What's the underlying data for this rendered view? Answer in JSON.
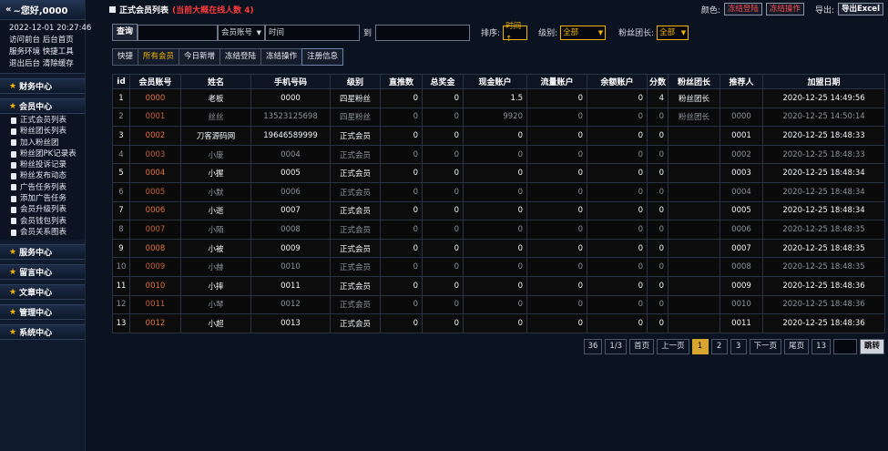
{
  "sidebar": {
    "greeting": "~您好,0000",
    "datetime": "2022-12-01 20:27:46",
    "links_row1": "访问前台 后台首页",
    "links_row2": "服务环境 快捷工具",
    "links_row3": "退出后台 清除缓存",
    "sections": {
      "finance": "财务中心",
      "member": "会员中心",
      "service": "服务中心",
      "message": "留言中心",
      "article": "文章中心",
      "manage": "管理中心",
      "system": "系统中心"
    },
    "member_items": [
      "正式会员列表",
      "粉丝团长列表",
      "加入粉丝团",
      "粉丝团PK记录表",
      "粉丝投诉记录",
      "粉丝发布动态",
      "广告任务列表",
      "添加广告任务",
      "会员升级列表",
      "会员钱包列表",
      "会员关系图表"
    ]
  },
  "header": {
    "title": "正式会员列表",
    "online_note": "(当前大概在线人数 4)",
    "color_label": "颜色:",
    "freeze_login": "冻结登陆",
    "freeze_op": "冻结操作",
    "export_label": "导出:",
    "export_excel": "导出Excel"
  },
  "search": {
    "query_btn": "查询",
    "field_select": "会员账号",
    "time_label": "时间",
    "to_label": "到",
    "sort_label": "排序:",
    "sort_value": "时间↑",
    "level_label": "级别:",
    "level_value": "全部",
    "fan_leader_label": "粉丝团长:",
    "fan_leader_value": "全部"
  },
  "tabs": [
    "快捷",
    "所有会员",
    "今日新增",
    "冻结登陆",
    "冻结操作",
    "注册信息"
  ],
  "table": {
    "headers": [
      "id",
      "会员账号",
      "姓名",
      "手机号码",
      "级别",
      "直推数",
      "总奖金",
      "现金账户",
      "流量账户",
      "余额账户",
      "分数",
      "粉丝团长",
      "推荐人",
      "加盟日期"
    ],
    "rows": [
      [
        "1",
        "0000",
        "老板",
        "0000",
        "四星粉丝",
        "0",
        "0",
        "1.5",
        "0",
        "0",
        "4",
        "粉丝团长",
        "",
        "2020-12-25 14:49:56"
      ],
      [
        "2",
        "0001",
        "丝丝",
        "13523125698",
        "四星粉丝",
        "0",
        "0",
        "9920",
        "0",
        "0",
        "0",
        "粉丝团长",
        "0000",
        "2020-12-25 14:50:14"
      ],
      [
        "3",
        "0002",
        "刀客源码网",
        "19646589999",
        "正式会员",
        "0",
        "0",
        "0",
        "0",
        "0",
        "0",
        "",
        "0001",
        "2020-12-25 18:48:33"
      ],
      [
        "4",
        "0003",
        "小废",
        "0004",
        "正式会员",
        "0",
        "0",
        "0",
        "0",
        "0",
        "0",
        "",
        "0002",
        "2020-12-25 18:48:33"
      ],
      [
        "5",
        "0004",
        "小握",
        "0005",
        "正式会员",
        "0",
        "0",
        "0",
        "0",
        "0",
        "0",
        "",
        "0003",
        "2020-12-25 18:48:34"
      ],
      [
        "6",
        "0005",
        "小默",
        "0006",
        "正式会员",
        "0",
        "0",
        "0",
        "0",
        "0",
        "0",
        "",
        "0004",
        "2020-12-25 18:48:34"
      ],
      [
        "7",
        "0006",
        "小逝",
        "0007",
        "正式会员",
        "0",
        "0",
        "0",
        "0",
        "0",
        "0",
        "",
        "0005",
        "2020-12-25 18:48:34"
      ],
      [
        "8",
        "0007",
        "小陌",
        "0008",
        "正式会员",
        "0",
        "0",
        "0",
        "0",
        "0",
        "0",
        "",
        "0006",
        "2020-12-25 18:48:35"
      ],
      [
        "9",
        "0008",
        "小被",
        "0009",
        "正式会员",
        "0",
        "0",
        "0",
        "0",
        "0",
        "0",
        "",
        "0007",
        "2020-12-25 18:48:35"
      ],
      [
        "10",
        "0009",
        "小赫",
        "0010",
        "正式会员",
        "0",
        "0",
        "0",
        "0",
        "0",
        "0",
        "",
        "0008",
        "2020-12-25 18:48:35"
      ],
      [
        "11",
        "0010",
        "小摔",
        "0011",
        "正式会员",
        "0",
        "0",
        "0",
        "0",
        "0",
        "0",
        "",
        "0009",
        "2020-12-25 18:48:36"
      ],
      [
        "12",
        "0011",
        "小琴",
        "0012",
        "正式会员",
        "0",
        "0",
        "0",
        "0",
        "0",
        "0",
        "",
        "0010",
        "2020-12-25 18:48:36"
      ],
      [
        "13",
        "0012",
        "小超",
        "0013",
        "正式会员",
        "0",
        "0",
        "0",
        "0",
        "0",
        "0",
        "",
        "0011",
        "2020-12-25 18:48:36"
      ]
    ]
  },
  "pager": {
    "total": "36",
    "page_of": "1/3",
    "first": "首页",
    "prev": "上一页",
    "pages": [
      "1",
      "2",
      "3"
    ],
    "current": "1",
    "next": "下一页",
    "last": "尾页",
    "per_page": "13",
    "go": "跳转"
  }
}
